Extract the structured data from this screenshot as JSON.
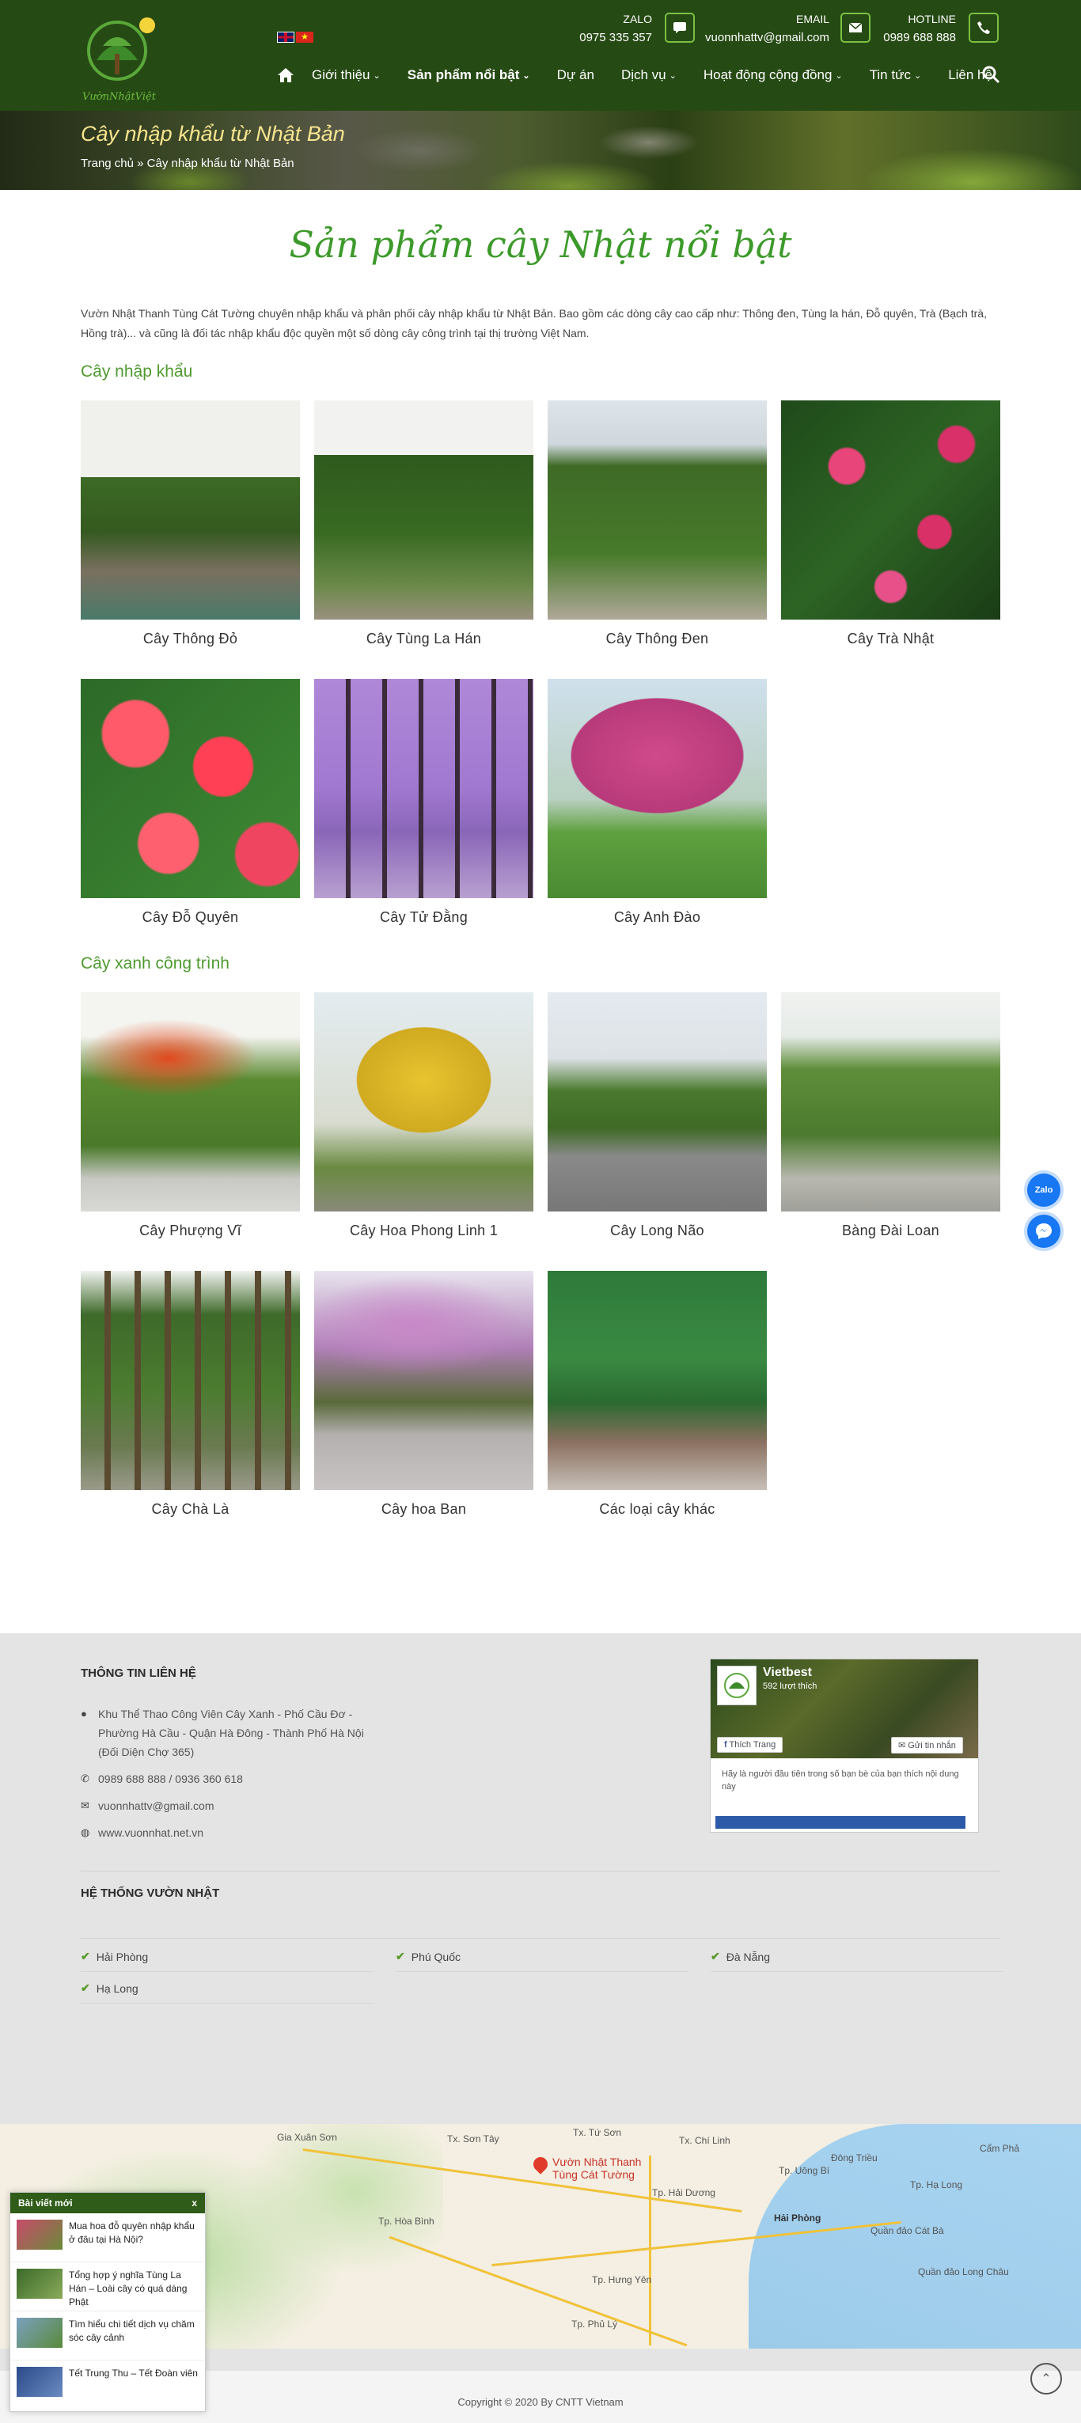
{
  "header": {
    "logo_text": "VườnNhậtViệt",
    "flags": [
      "uk-flag",
      "vn-flag"
    ],
    "zalo": {
      "label": "ZALO",
      "value": "0975 335 357"
    },
    "email": {
      "label": "EMAIL",
      "value": "vuonnhattv@gmail.com"
    },
    "hotline": {
      "label": "HOTLINE",
      "value": "0989 688 888"
    },
    "nav": [
      {
        "label": "Giới thiệu"
      },
      {
        "label": "Sản phẩm nổi bật"
      },
      {
        "label": "Dự án"
      },
      {
        "label": "Dịch vụ"
      },
      {
        "label": "Hoạt động cộng đồng"
      },
      {
        "label": "Tin tức"
      },
      {
        "label": "Liên hệ"
      }
    ]
  },
  "banner": {
    "title": "Cây nhập khẩu từ Nhật Bản",
    "breadcrumb": "Trang chủ » Cây nhập khẩu từ Nhật Bản"
  },
  "main": {
    "title": "Sản phẩm cây Nhật nổi bật",
    "intro": "Vườn Nhật Thanh Tùng Cát Tường chuyên nhập khẩu và phân phối cây nhập khẩu từ Nhật Bản. Bao gồm các dòng cây cao cấp như: Thông đen, Tùng la hán, Đỗ quyên, Trà (Bạch trà, Hồng trà)... và cũng là đối tác nhập khẩu độc quyền một số dòng cây công trình tại thị trường Việt Nam.",
    "section1": {
      "title": "Cây nhập khẩu",
      "items": [
        "Cây Thông Đỏ",
        "Cây Tùng La Hán",
        "Cây Thông Đen",
        "Cây Trà Nhật",
        "Cây Đỗ Quyên",
        "Cây Tử Đằng",
        "Cây Anh Đào"
      ]
    },
    "section2": {
      "title": "Cây xanh công trình",
      "items": [
        "Cây Phượng Vĩ",
        "Cây Hoa Phong Linh 1",
        "Cây Long Não",
        "Bàng Đài Loan",
        "Cây Chà Là",
        "Cây hoa Ban",
        "Các loại cây khác"
      ]
    }
  },
  "footer": {
    "contact_title": "THÔNG TIN LIÊN HỆ",
    "address": "Khu Thể Thao Công Viên Cây Xanh - Phố Cầu Đơ - Phường Hà Cầu - Quận Hà Đông - Thành Phố Hà Nội (Đối Diện Chợ 365)",
    "phone": "0989 688 888 / 0936 360 618",
    "email": "vuonnhattv@gmail.com",
    "website": "www.vuonnhat.net.vn",
    "fb": {
      "name": "Vietbest",
      "likes": "592 lượt thích",
      "like_btn": "Thích Trang",
      "msg_btn": "Gửi tin nhắn",
      "feed": "Hãy là người đầu tiên trong số bạn bè của bạn thích nội dung này"
    },
    "system_title": "HỆ THỐNG VƯỜN NHẬT",
    "branches": [
      "Hải Phòng",
      "Phú Quốc",
      "Đà Nẵng",
      "Hạ Long"
    ]
  },
  "map": {
    "pin_label": "Vườn Nhật Thanh Tùng Cát Tường",
    "places": [
      "Gia Xuân Sơn",
      "Tx. Sơn Tây",
      "Tx. Tứ Sơn",
      "Tx. Chí Linh",
      "Đông Triều",
      "Cẩm Phả",
      "Tp. Hạ Long",
      "Tp. Uông Bí",
      "Tp. Hải Dương",
      "Hải Phòng",
      "Tp. Hòa Bình",
      "Tp. Hưng Yên",
      "Tp. Phủ Lý",
      "Quần đảo Cát Bà",
      "Quần đảo Long Châu"
    ]
  },
  "news": {
    "title": "Bài viết mới",
    "close": "x",
    "items": [
      "Mua hoa đỗ quyên nhập khẩu ở đâu tại Hà Nội?",
      "Tổng hợp ý nghĩa Tùng La Hán – Loài cây có quá dáng Phật",
      "Tìm hiểu chi tiết dịch vụ chăm sóc cây cảnh",
      "Tết Trung Thu – Tết Đoàn viên"
    ]
  },
  "float": {
    "zalo": "Zalo"
  },
  "copyright": "Copyright © 2020 By CNTT Vietnam",
  "colors": {
    "header_bg": "#264a14",
    "accent_green": "#4f9a2f",
    "title_green": "#3c9a2a",
    "banner_title": "#f7e48f"
  }
}
